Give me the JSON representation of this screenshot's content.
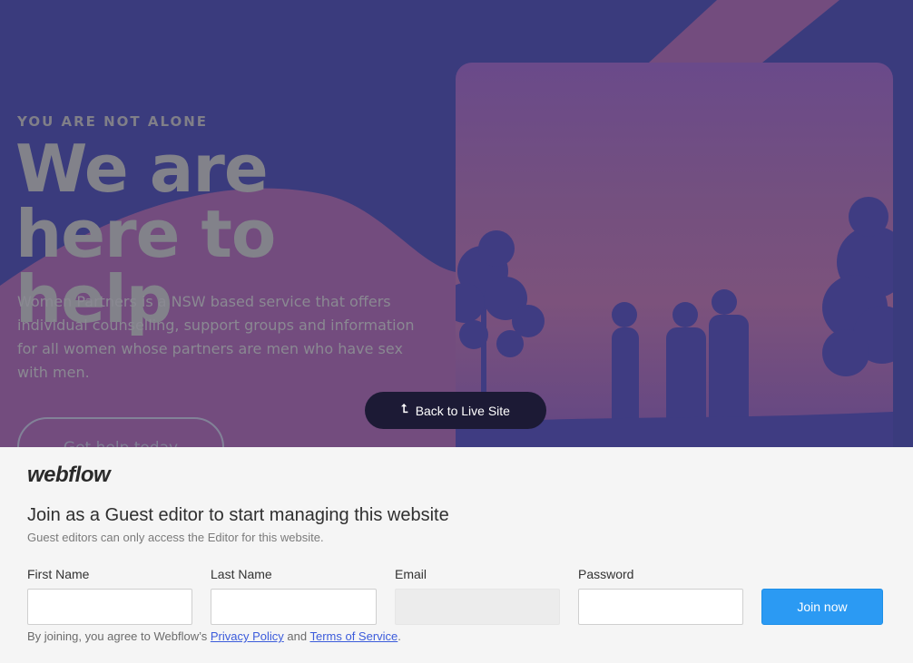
{
  "hero": {
    "eyebrow": "YOU ARE NOT ALONE",
    "headline": "We are here to help",
    "intro": "Women Partners is a NSW based service that offers individual counselling, support groups and information for all women whose partners are men who have sex with men.",
    "cta_label": "Get help today",
    "colors": {
      "background": "#3a3b7d",
      "accent_shape": "#7a4f7e"
    }
  },
  "back_pill": {
    "label": "Back to Live Site",
    "icon": "arrow-up-icon"
  },
  "panel": {
    "brand": "webflow",
    "title": "Join as a Guest editor to start managing this website",
    "subtitle": "Guest editors can only access the Editor for this website.",
    "fields": {
      "first_name": {
        "label": "First Name",
        "value": ""
      },
      "last_name": {
        "label": "Last Name",
        "value": ""
      },
      "email": {
        "label": "Email",
        "value": ""
      },
      "password": {
        "label": "Password",
        "value": ""
      }
    },
    "join_label": "Join now",
    "legal": {
      "prefix": "By joining, you agree to Webflow’s ",
      "privacy": "Privacy Policy",
      "and": " and ",
      "terms": "Terms of Service",
      "suffix": "."
    },
    "accent": "#2b9af3"
  }
}
